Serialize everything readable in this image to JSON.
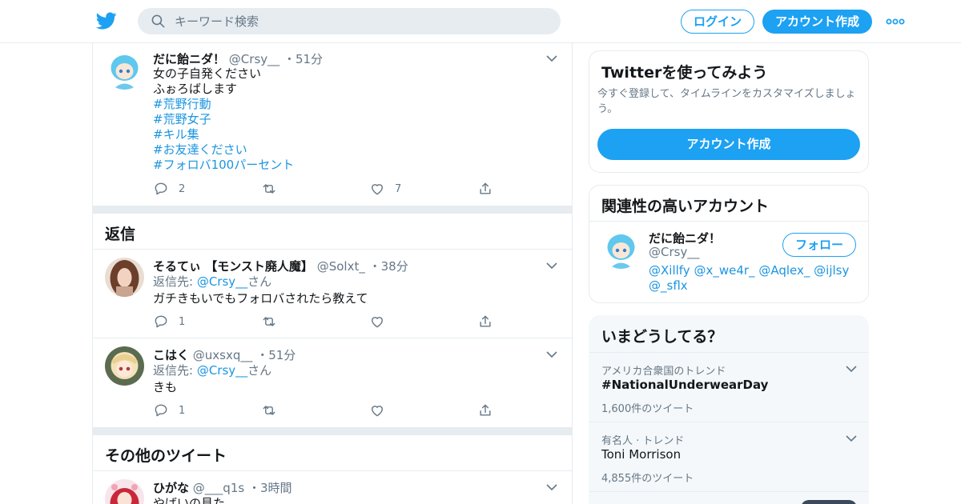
{
  "header": {
    "search_placeholder": "キーワード検索",
    "login_label": "ログイン",
    "signup_label": "アカウント作成",
    "brand_color": "#1da1f2",
    "icons": [
      "twitter-bird-icon",
      "search-icon",
      "more-dots-icon"
    ]
  },
  "main_tweet": {
    "name": "だに飴ニダ！",
    "handle": "@Crsy__",
    "separator": "・",
    "time": "51分",
    "lines": [
      "女の子自発ください",
      "ふぉろばします"
    ],
    "hashtags": [
      "#荒野行動",
      "#荒野女子",
      "#キル集",
      "#お友達ください",
      "#フォロバ100パーセント"
    ],
    "reply_count": "2",
    "retweet_count": "",
    "like_count": "7"
  },
  "replies_section": {
    "title": "返信",
    "replies": [
      {
        "name": "そるてぃ 【モンスト廃人魔】",
        "handle": "@Solxt_",
        "separator": "・",
        "time": "38分",
        "reply_to_label": "返信先: ",
        "reply_to_handle": "@Crsy__",
        "reply_to_suffix": "さん",
        "text": "ガチきもいでもフォロバされたら教えて",
        "reply_count": "1",
        "retweet_count": "",
        "like_count": ""
      },
      {
        "name": "こはく",
        "handle": "@uxsxq__",
        "separator": "・",
        "time": "51分",
        "reply_to_label": "返信先: ",
        "reply_to_handle": "@Crsy__",
        "reply_to_suffix": "さん",
        "text": "きも",
        "reply_count": "1",
        "retweet_count": "",
        "like_count": ""
      }
    ]
  },
  "other_section": {
    "title": "その他のツイート",
    "tweet": {
      "name": "ひがな",
      "handle": "@___q1s",
      "separator": "・",
      "time": "3時間",
      "text": "やばいの見た"
    }
  },
  "signup_card": {
    "title": "Twitterを使ってみよう",
    "description": "今すぐ登録して、タイムラインをカスタマイズしましょう。",
    "button_label": "アカウント作成"
  },
  "related_card": {
    "title": "関連性の高いアカウント",
    "account": {
      "name": "だに飴ニダ！",
      "handle": "@Crsy__",
      "follow_label": "フォロー",
      "mentions": [
        "@Xillfy",
        "@x_we4r_",
        "@Aqlex_",
        "@ijlsy",
        "@_sflx"
      ]
    }
  },
  "trends_card": {
    "title": "いまどうしてる？",
    "trends": [
      {
        "context": "アメリカ合衆国のトレンド",
        "name": "#NationalUnderwearDay",
        "count": "1,600件のツイート"
      },
      {
        "context": "有名人 · トレンド",
        "name": "Toni Morrison",
        "count": "4,855件のツイート"
      }
    ]
  }
}
